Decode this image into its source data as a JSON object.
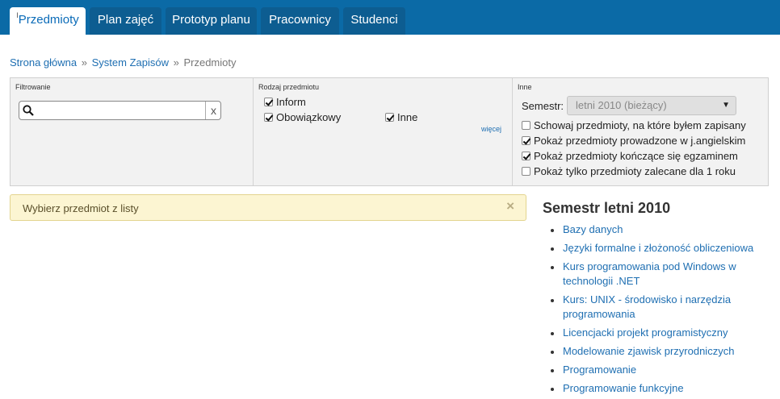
{
  "nav": {
    "tabs": [
      {
        "label": "Przedmioty",
        "marker": "I"
      },
      {
        "label": "Plan zajęć"
      },
      {
        "label": "Prototyp planu"
      },
      {
        "label": "Pracownicy"
      },
      {
        "label": "Studenci"
      }
    ],
    "active_tab": "Przedmioty"
  },
  "breadcrumb": {
    "items": [
      "Strona główna",
      "System Zapisów",
      "Przedmioty"
    ],
    "separator": "»"
  },
  "filters": {
    "search": {
      "title": "Filtrowanie",
      "value": "",
      "clear_label": "x"
    },
    "type": {
      "title": "Rodzaj przedmiotu",
      "options": [
        {
          "label": "Inform",
          "checked": true
        },
        {
          "label": "Obowiązkowy",
          "checked": true
        },
        {
          "label": "Inne",
          "checked": true
        }
      ],
      "more_link": "więcej"
    },
    "other": {
      "title": "Inne",
      "semester_label": "Semestr:",
      "semester_value": "letni 2010 (bieżący)",
      "options": [
        {
          "label": "Schowaj przedmioty, na które byłem zapisany",
          "checked": false
        },
        {
          "label": "Pokaż przedmioty prowadzone w j.angielskim",
          "checked": true
        },
        {
          "label": "Pokaż przedmioty kończące się egzaminem",
          "checked": true
        },
        {
          "label": "Pokaż tylko przedmioty zalecane dla 1 roku",
          "checked": false
        }
      ]
    }
  },
  "alert": {
    "message": "Wybierz przedmiot z listy",
    "close": "×"
  },
  "semester": {
    "title": "Semestr letni 2010",
    "courses": [
      "Bazy danych",
      "Języki formalne i złożoność obliczeniowa",
      "Kurs programowania pod Windows w technologii .NET",
      "Kurs: UNIX - środowisko i narzędzia programowania",
      "Licencjacki projekt programistyczny",
      "Modelowanie zjawisk przyrodniczych",
      "Programowanie",
      "Programowanie funkcyjne"
    ]
  },
  "colors": {
    "topbar": "#0b6aa6",
    "tab_bg": "#0d5d91",
    "link": "#1f6fb2",
    "alert_bg": "#fcf5d2"
  }
}
